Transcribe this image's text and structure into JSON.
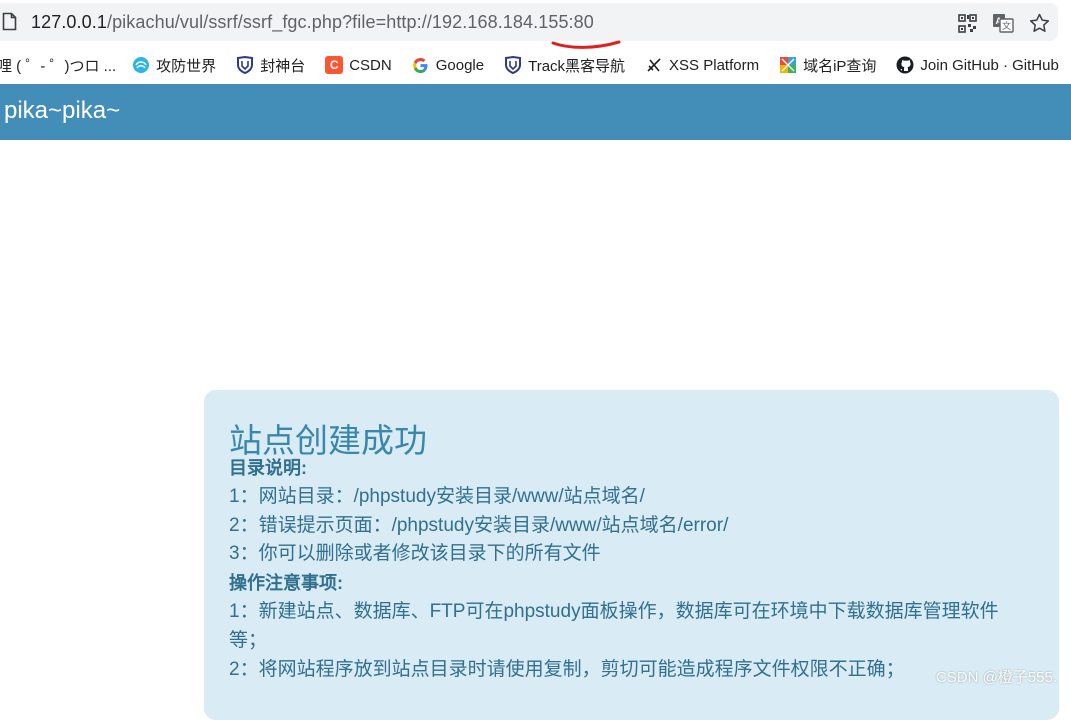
{
  "browser": {
    "url_host": "127.0.0.1",
    "url_rest": "/pikachu/vul/ssrf/ssrf_fgc.php?file=http://192.168.184.155:80",
    "bookmarks": [
      {
        "label": "哩 ( ゜- ゜)つロ ...",
        "icon": "none"
      },
      {
        "label": "攻防世界",
        "icon": "globe-swirl-icon"
      },
      {
        "label": "封神台",
        "icon": "shield-icon"
      },
      {
        "label": "CSDN",
        "icon": "csdn-icon"
      },
      {
        "label": "Google",
        "icon": "google-icon"
      },
      {
        "label": "Track黑客导航",
        "icon": "shield-icon"
      },
      {
        "label": "XSS Platform",
        "icon": "sword-icon"
      },
      {
        "label": "域名iP查询",
        "icon": "puzzle-icon"
      },
      {
        "label": "Join GitHub · GitHub",
        "icon": "github-icon"
      }
    ]
  },
  "site": {
    "title": "pika~pika~"
  },
  "panel": {
    "title": "站点创建成功",
    "heading1": "目录说明:",
    "lines1": [
      "1：网站目录：/phpstudy安装目录/www/站点域名/",
      "2：错误提示页面：/phpstudy安装目录/www/站点域名/error/",
      "3：你可以删除或者修改该目录下的所有文件"
    ],
    "heading2": "操作注意事项:",
    "lines2": [
      "1：新建站点、数据库、FTP可在phpstudy面板操作，数据库可在环境中下载数据库管理软件等；",
      "2：将网站程序放到站点目录时请使用复制，剪切可能造成程序文件权限不正确；"
    ]
  },
  "watermark": "CSDN @橙子555.",
  "colors": {
    "header": "#438eb9",
    "panel_bg": "#d9ebf5",
    "panel_text": "#31708f",
    "annotation": "#e02020"
  }
}
